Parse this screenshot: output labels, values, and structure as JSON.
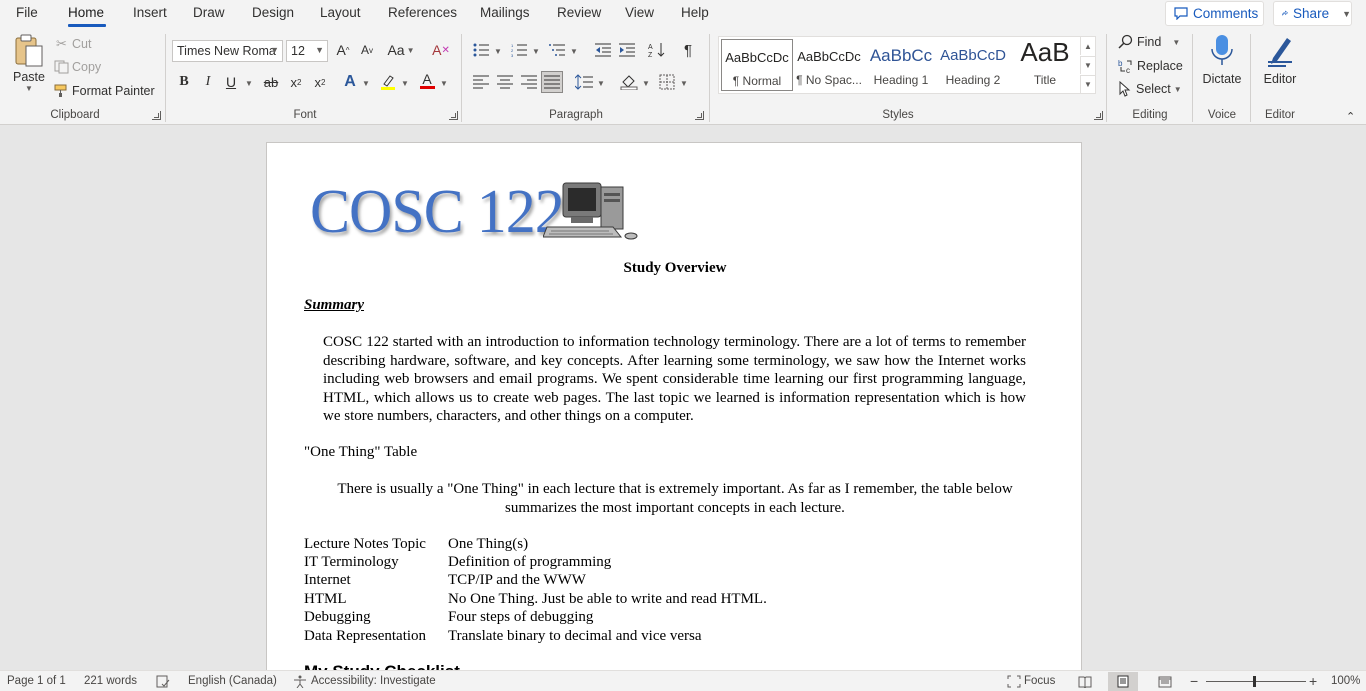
{
  "menu": {
    "tabs": [
      "File",
      "Home",
      "Insert",
      "Draw",
      "Design",
      "Layout",
      "References",
      "Mailings",
      "Review",
      "View",
      "Help"
    ],
    "active_tab": "Home",
    "comments_label": "Comments",
    "share_label": "Share"
  },
  "ribbon": {
    "clipboard": {
      "paste": "Paste",
      "cut": "Cut",
      "copy": "Copy",
      "format_painter": "Format Painter",
      "label": "Clipboard"
    },
    "font": {
      "font_name": "Times New Roma",
      "font_size": "12",
      "label": "Font"
    },
    "paragraph": {
      "label": "Paragraph"
    },
    "styles": {
      "label": "Styles",
      "items": [
        {
          "sample": "AaBbCcDc",
          "name": "¶ Normal"
        },
        {
          "sample": "AaBbCcDc",
          "name": "¶ No Spac..."
        },
        {
          "sample": "AaBbCc",
          "name": "Heading 1"
        },
        {
          "sample": "AaBbCcD",
          "name": "Heading 2"
        },
        {
          "sample": "AaB",
          "name": "Title"
        }
      ]
    },
    "editing": {
      "find": "Find",
      "replace": "Replace",
      "select": "Select",
      "label": "Editing"
    },
    "voice": {
      "dictate": "Dictate",
      "label": "Voice"
    },
    "editor": {
      "editor": "Editor",
      "label": "Editor"
    }
  },
  "document": {
    "logo_text": "COSC 122",
    "title": "Study Overview",
    "summary_heading": "Summary",
    "summary_para": "COSC 122 started with an introduction to information technology terminology. There are a lot of terms to remember describing hardware, software, and key concepts.  After learning some terminology, we saw how the Internet works including web browsers and email programs.  We spent considerable time learning our first programming language, HTML, which allows us to create web pages.  The last topic we learned is information representation which is how we store numbers, characters, and other things on a computer.",
    "one_thing_heading": "\"One Thing\" Table",
    "one_thing_intro": "There is usually a \"One Thing\" in each lecture that is extremely important.  As far as I remember, the table below summarizes the most important concepts in each lecture.",
    "table": [
      [
        "Lecture Notes Topic",
        "One Thing(s)"
      ],
      [
        "IT Terminology",
        "Definition of programming"
      ],
      [
        "Internet",
        "TCP/IP and the WWW"
      ],
      [
        "HTML",
        "No One Thing. Just be able to write and read HTML."
      ],
      [
        "Debugging",
        "Four steps of debugging"
      ],
      [
        "Data Representation",
        "Translate binary to decimal and vice versa"
      ]
    ],
    "next_heading": "My Study Checklist"
  },
  "status": {
    "page": "Page 1 of 1",
    "words": "221 words",
    "language": "English (Canada)",
    "accessibility": "Accessibility: Investigate",
    "focus": "Focus",
    "zoom": "100%"
  }
}
